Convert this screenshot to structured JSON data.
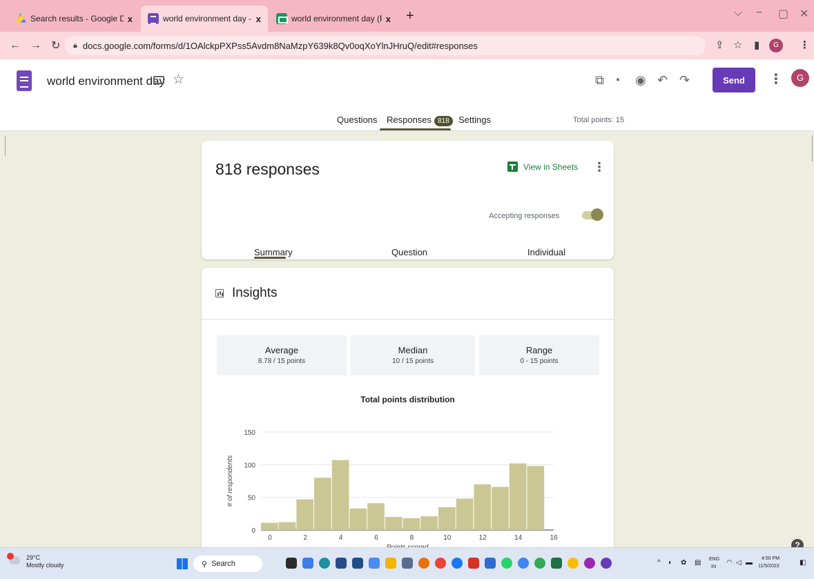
{
  "browser": {
    "tabs": [
      {
        "title": "Search results - Google Drive",
        "icon": "google-drive-icon"
      },
      {
        "title": "world environment day - Googl",
        "icon": "google-forms-icon"
      },
      {
        "title": "world environment day (Respon",
        "icon": "google-sheets-icon"
      }
    ],
    "tab_close": "x",
    "new_tab": "+",
    "url": "docs.google.com/forms/d/1OAlckpPXPss5Avdm8NaMzpY639k8Qv0oqXoYlnJHruQ/edit#responses",
    "profile_initial": "G"
  },
  "form": {
    "title": "world environment day",
    "send_label": "Send",
    "avatar_initial": "G",
    "tabs": {
      "questions": "Questions",
      "responses": "Responses",
      "settings": "Settings"
    },
    "response_badge": "818",
    "total_points": "Total points: 15"
  },
  "responses_card": {
    "count_label": "818 responses",
    "view_in_sheets": "View in Sheets",
    "accepting_label": "Accepting responses",
    "subtabs": {
      "summary": "Summary",
      "question": "Question",
      "individual": "Individual"
    }
  },
  "insights": {
    "title": "Insights",
    "stats": [
      {
        "label": "Average",
        "value": "8.78 / 15 points"
      },
      {
        "label": "Median",
        "value": "10 / 15 points"
      },
      {
        "label": "Range",
        "value": "0 - 15 points"
      }
    ]
  },
  "chart_data": {
    "type": "bar",
    "title": "Total points distribution",
    "xlabel": "Points scored",
    "ylabel": "# of respondents",
    "x": [
      0,
      1,
      2,
      3,
      4,
      5,
      6,
      7,
      8,
      9,
      10,
      11,
      12,
      13,
      14,
      15
    ],
    "values": [
      11,
      12,
      47,
      80,
      107,
      33,
      41,
      20,
      18,
      21,
      35,
      48,
      70,
      66,
      102,
      98
    ],
    "xticks": [
      0,
      2,
      4,
      6,
      8,
      10,
      12,
      14,
      16
    ],
    "yticks": [
      0,
      50,
      100,
      150
    ],
    "ylim": [
      0,
      150
    ],
    "xlim": [
      -0.5,
      16
    ],
    "bar_color": "#cbc794",
    "grid": true
  },
  "taskbar": {
    "temperature": "29°C",
    "weather": "Mostly cloudy",
    "search_label": "Search",
    "lang_top": "ENG",
    "lang_bottom": "IN",
    "time": "4:50 PM",
    "date": "11/5/2023"
  },
  "help_label": "?"
}
